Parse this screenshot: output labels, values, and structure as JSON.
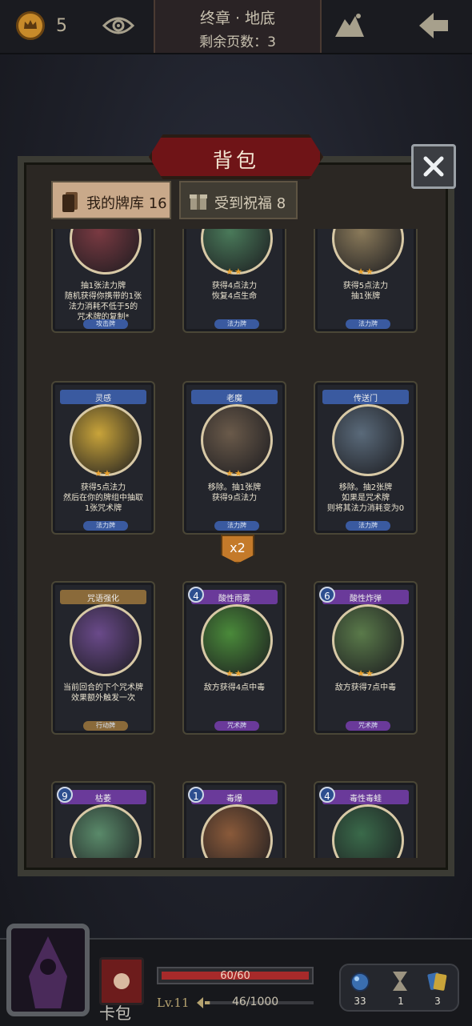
{
  "topbar": {
    "coins": "5",
    "chapter_title": "终章 · 地底",
    "pages_left": "剩余页数：3"
  },
  "panel": {
    "banner": "背包",
    "tabs": [
      {
        "label": "我的牌库 16",
        "active": true
      },
      {
        "label": "受到祝福 8",
        "active": false
      }
    ]
  },
  "cards": [
    {
      "name": "",
      "cost": "",
      "stars": 0,
      "desc": "抽1张法力牌\n随机获得你携带的1张\n法力消耗不低于5的\n咒术牌的复制*",
      "type": "攻击牌",
      "color": "#3a5aa0",
      "art": "#7a3a42"
    },
    {
      "name": "",
      "cost": "",
      "stars": 2,
      "desc": "获得4点法力\n恢复4点生命",
      "type": "法力牌",
      "color": "#3a5aa0",
      "art": "#4a7a5a"
    },
    {
      "name": "",
      "cost": "",
      "stars": 2,
      "desc": "获得5点法力\n抽1张牌",
      "type": "法力牌",
      "color": "#3a5aa0",
      "art": "#8a7a5a"
    },
    {
      "name": "灵感",
      "cost": "",
      "stars": 2,
      "desc": "获得5点法力\n然后在你的牌组中抽取\n1张咒术牌",
      "type": "法力牌",
      "color": "#3a5aa0",
      "art": "#c9a43a"
    },
    {
      "name": "老魔",
      "cost": "",
      "stars": 2,
      "desc": "移除。抽1张牌\n获得9点法力",
      "type": "法力牌",
      "color": "#3a5aa0",
      "art": "#6a5a4a"
    },
    {
      "name": "传送门",
      "cost": "",
      "stars": 0,
      "desc": "移除。抽2张牌\n如果是咒术牌\n则将其法力消耗变为0",
      "type": "法力牌",
      "color": "#3a5aa0",
      "art": "#5a6a7a"
    },
    {
      "name": "咒语强化",
      "cost": "",
      "stars": 0,
      "desc": "当前回合的下个咒术牌\n效果额外触发一次",
      "type": "行动牌",
      "color": "#8a6a3a",
      "art": "#6a4a8a"
    },
    {
      "name": "酸性雨雾",
      "cost": "4",
      "stars": 2,
      "desc": "敌方获得4点中毒",
      "type": "咒术牌",
      "color": "#6a3a9a",
      "art": "#4a8a3a"
    },
    {
      "name": "酸性炸弹",
      "cost": "6",
      "stars": 2,
      "desc": "敌方获得7点中毒",
      "type": "咒术牌",
      "color": "#6a3a9a",
      "art": "#5a7a4a"
    },
    {
      "name": "枯萎",
      "cost": "9",
      "stars": 0,
      "desc": "",
      "type": "",
      "color": "#6a3a9a",
      "art": "#5a8a6a"
    },
    {
      "name": "毒爆",
      "cost": "1",
      "stars": 0,
      "desc": "",
      "type": "",
      "color": "#6a3a9a",
      "art": "#8a5a3a"
    },
    {
      "name": "毒性毒蛙",
      "cost": "4",
      "stars": 0,
      "desc": "",
      "type": "",
      "color": "#6a3a9a",
      "art": "#3a6a4a"
    }
  ],
  "badge": "x2",
  "bottom": {
    "card_pack": "卡包",
    "hp": "60/60",
    "hp_fraction": 1.0,
    "level": "Lv.11",
    "xp": "46/1000",
    "xp_fraction": 0.046,
    "stats": [
      "33",
      "1",
      "3"
    ]
  }
}
